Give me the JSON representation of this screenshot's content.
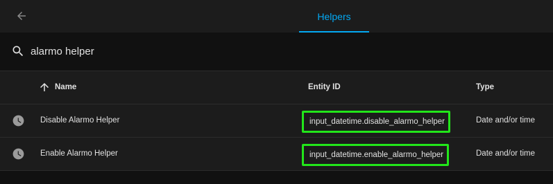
{
  "header": {
    "back_icon": "arrow-left-icon",
    "tab_label": "Helpers",
    "accent_color": "#03a9f4"
  },
  "search": {
    "icon": "search-icon",
    "value": "alarmo helper"
  },
  "table": {
    "sort_icon": "arrow-up-icon",
    "columns": [
      "Name",
      "Entity ID",
      "Type"
    ],
    "rows": [
      {
        "icon": "clock-icon",
        "name": "Disable Alarmo Helper",
        "entity_id": "input_datetime.disable_alarmo_helper",
        "type": "Date and/or time"
      },
      {
        "icon": "clock-icon",
        "name": "Enable Alarmo Helper",
        "entity_id": "input_datetime.enable_alarmo_helper",
        "type": "Date and/or time"
      }
    ],
    "highlight_color": "#22e61a"
  }
}
